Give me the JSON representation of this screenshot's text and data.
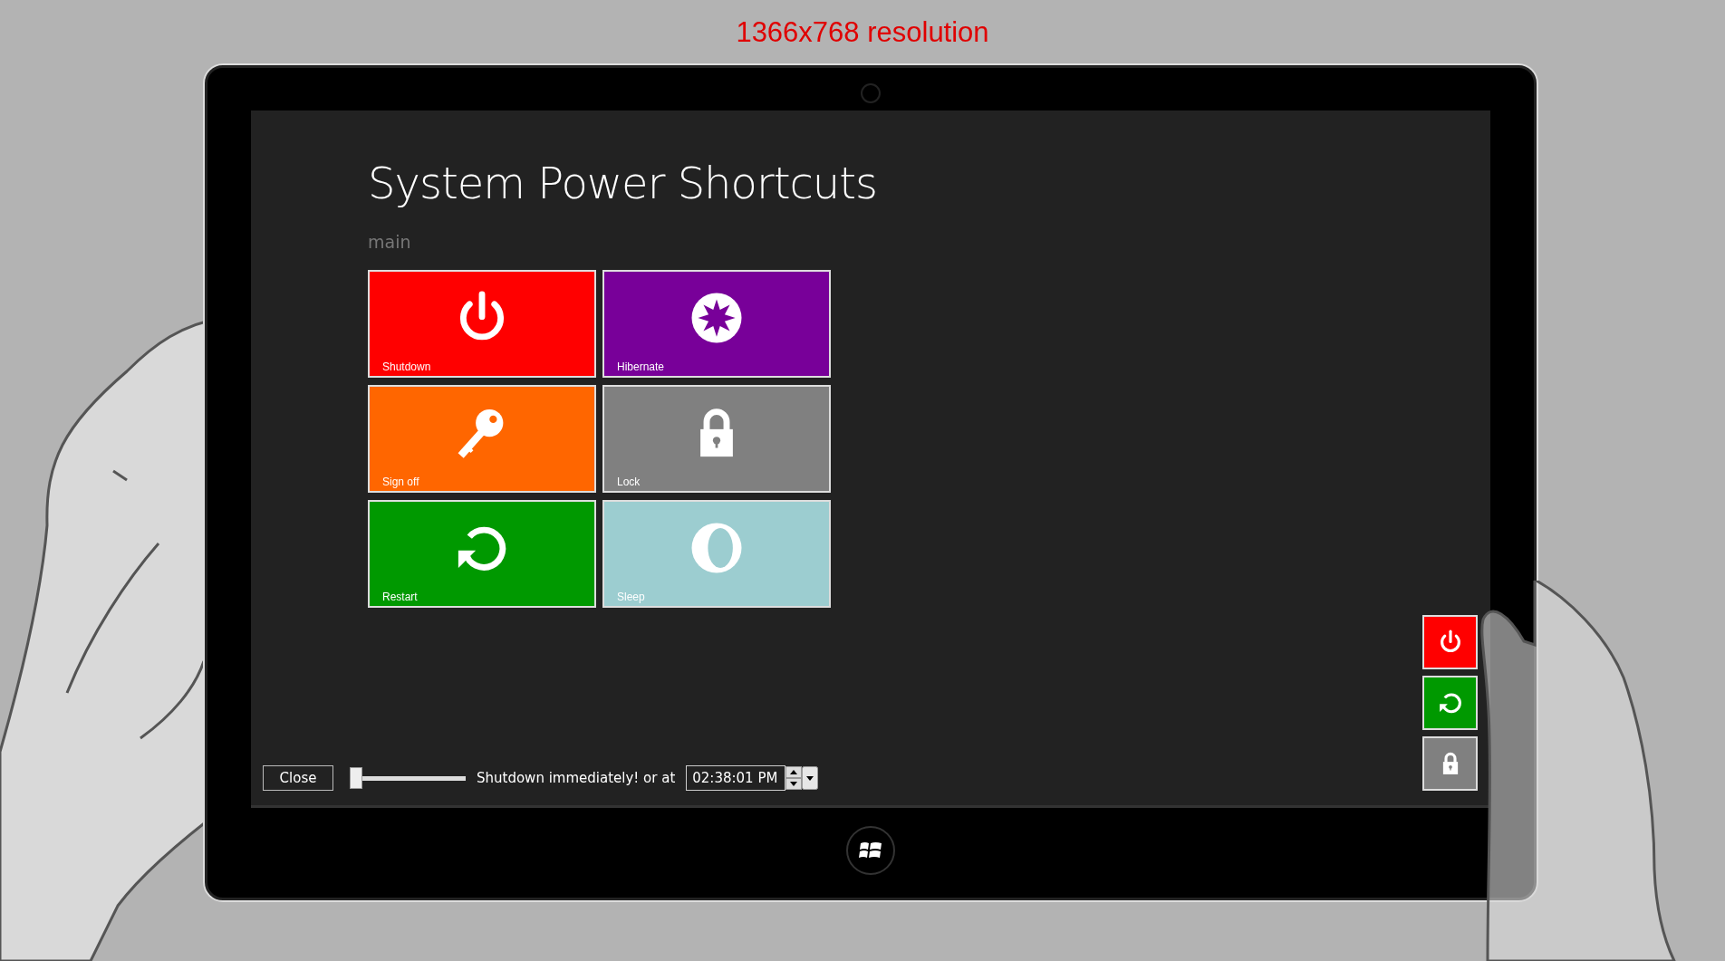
{
  "caption": "1366x768 resolution",
  "app": {
    "title": "System Power Shortcuts",
    "section": "main",
    "tiles": [
      {
        "label": "Shutdown",
        "kind": "power",
        "color": "#ff0000"
      },
      {
        "label": "Hibernate",
        "kind": "hibernate",
        "color": "#780099"
      },
      {
        "label": "Sign off",
        "kind": "key",
        "color": "#ff6600"
      },
      {
        "label": "Lock",
        "kind": "lock",
        "color": "#808080"
      },
      {
        "label": "Restart",
        "kind": "restart",
        "color": "#009900"
      },
      {
        "label": "Sleep",
        "kind": "sleep",
        "color": "#9ccdd0"
      }
    ],
    "bottom_bar": {
      "close_button": "Close",
      "delay_slider": {
        "level": 0
      },
      "delay_label": "Shutdown immediately! or at",
      "time_field": {
        "value": "02:38:01 PM"
      }
    },
    "quick_buttons": [
      {
        "kind": "power",
        "color": "#ff0000"
      },
      {
        "kind": "restart",
        "color": "#009900"
      },
      {
        "kind": "lock",
        "color": "#808080"
      }
    ]
  }
}
